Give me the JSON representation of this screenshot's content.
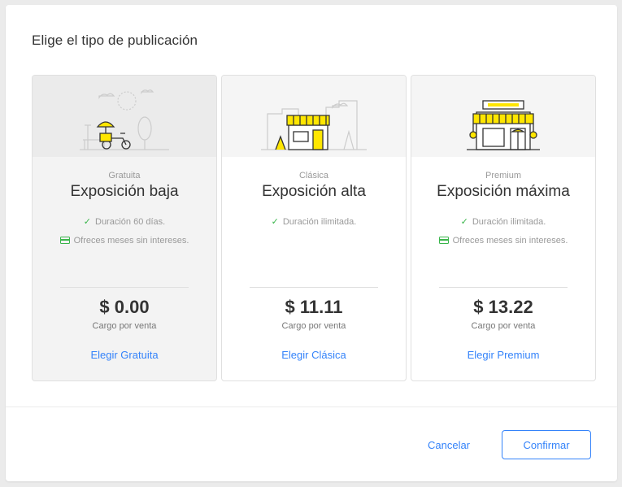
{
  "modal": {
    "title": "Elige el tipo de publicación",
    "cancel_label": "Cancelar",
    "confirm_label": "Confirmar"
  },
  "plans": [
    {
      "type": "Gratuita",
      "name": "Exposición baja",
      "features": [
        {
          "icon": "check-icon",
          "text": "Duración 60 días."
        },
        {
          "icon": "credit-card-icon",
          "text": "Ofreces meses sin intereses."
        }
      ],
      "price": "$ 0.00",
      "price_note": "Cargo por venta",
      "choose_label": "Elegir Gratuita",
      "selected": true
    },
    {
      "type": "Clásica",
      "name": "Exposición alta",
      "features": [
        {
          "icon": "check-icon",
          "text": "Duración ilimitada."
        }
      ],
      "price": "$ 11.11",
      "price_note": "Cargo por venta",
      "choose_label": "Elegir Clásica",
      "selected": false
    },
    {
      "type": "Premium",
      "name": "Exposición máxima",
      "features": [
        {
          "icon": "check-icon",
          "text": "Duración ilimitada."
        },
        {
          "icon": "credit-card-icon",
          "text": "Ofreces meses sin intereses."
        }
      ],
      "price": "$ 13.22",
      "price_note": "Cargo por venta",
      "choose_label": "Elegir Premium",
      "selected": false
    }
  ],
  "colors": {
    "accent": "#3483fa",
    "brand_yellow": "#ffe600",
    "check_green": "#39b54a"
  }
}
